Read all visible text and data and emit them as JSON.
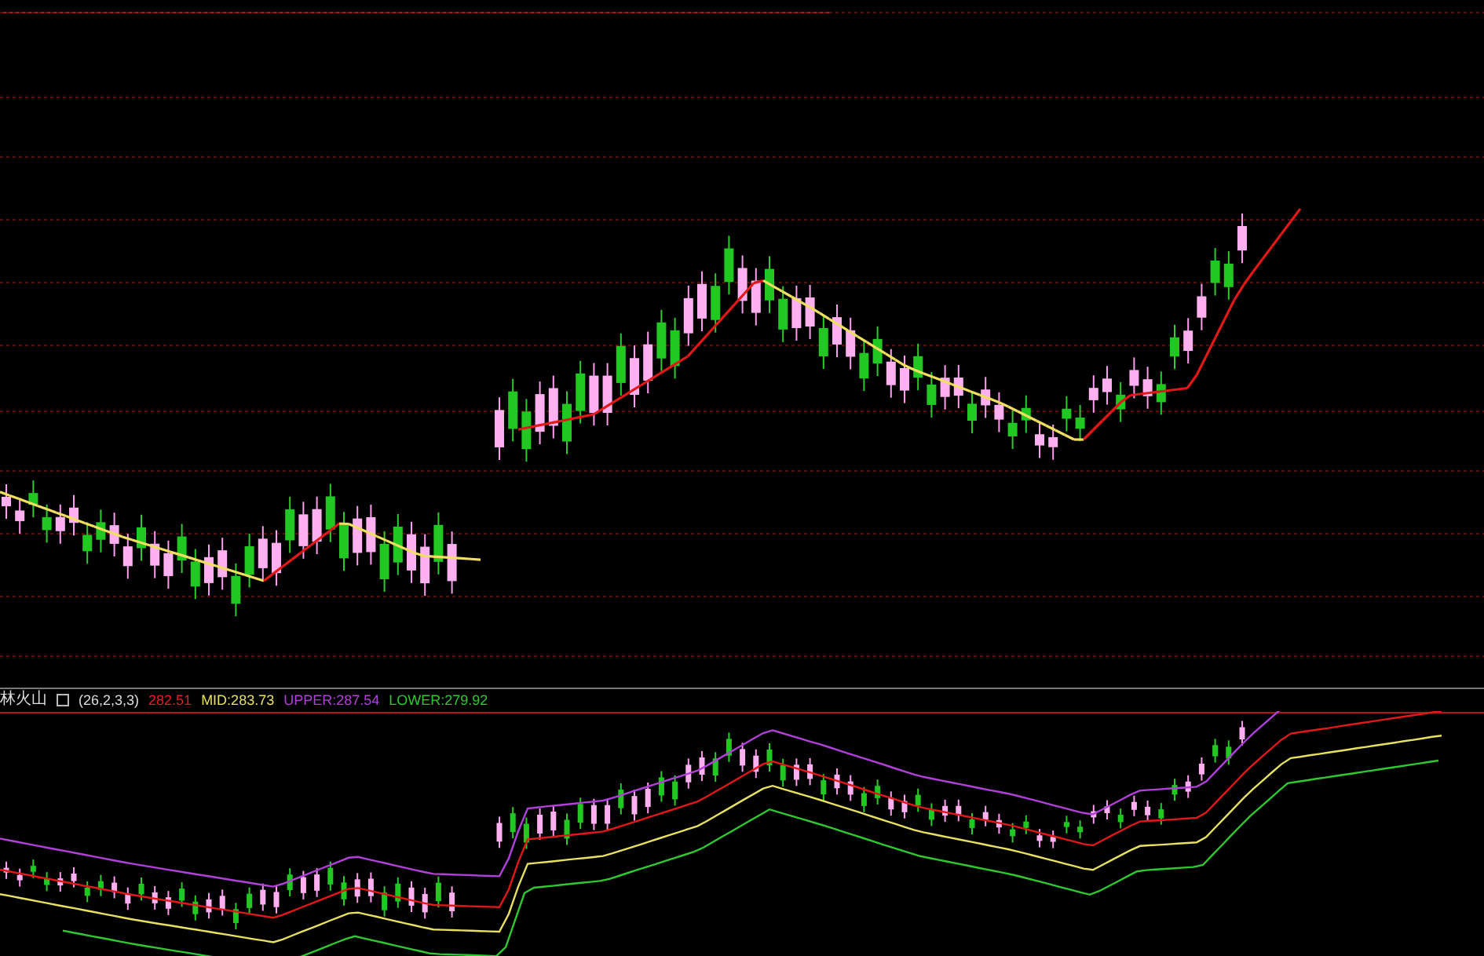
{
  "indicator": {
    "name": "林火山",
    "params": "(26,2,3,3)",
    "readings": [
      {
        "text": "282.51",
        "color": "#e02020"
      },
      {
        "text": "MID:283.73",
        "color": "#e8e060"
      },
      {
        "text": "UPPER:287.54",
        "color": "#b040d8"
      },
      {
        "text": "LOWER:279.92",
        "color": "#30c830"
      }
    ]
  }
}
